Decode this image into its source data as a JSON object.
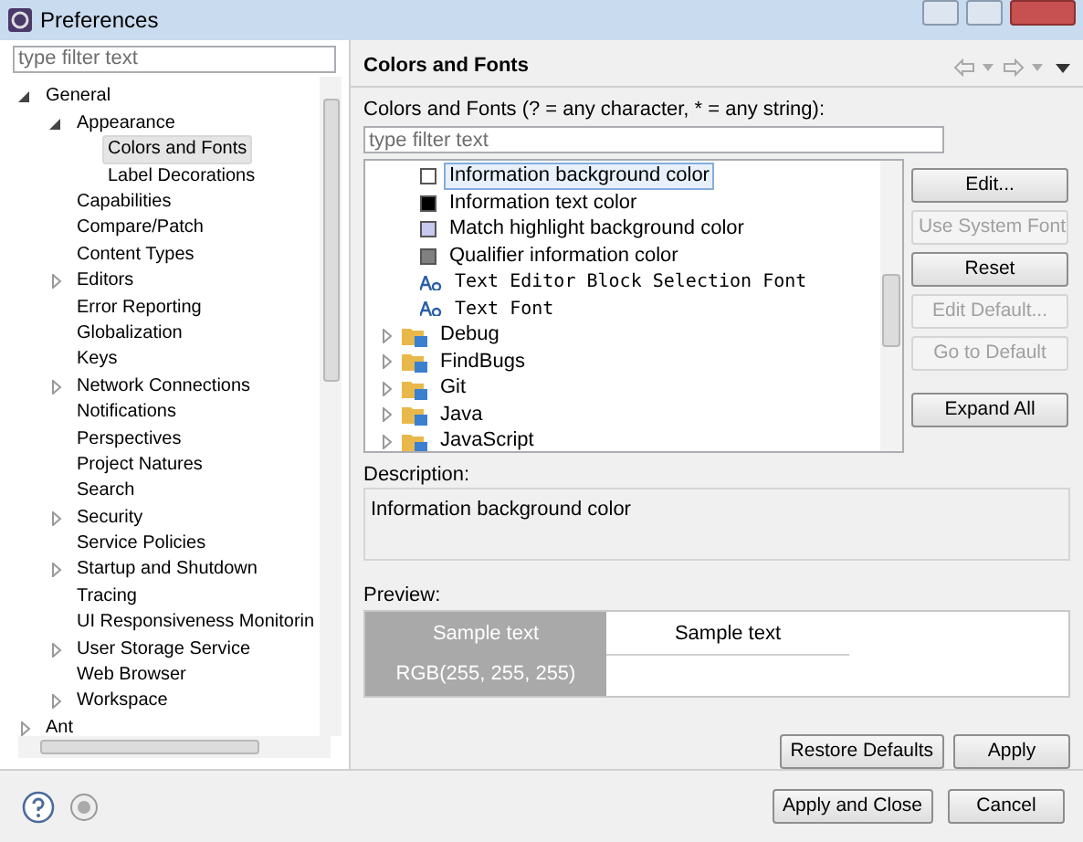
{
  "window": {
    "title": "Preferences"
  },
  "sidebar": {
    "filter": {
      "placeholder": "type filter text"
    },
    "tree": [
      {
        "label": "General",
        "expanded": true,
        "selected": false,
        "children": [
          {
            "label": "Appearance",
            "expanded": true,
            "selected": false,
            "children": [
              {
                "label": "Colors and Fonts",
                "selected": true
              },
              {
                "label": "Label Decorations",
                "selected": false
              }
            ]
          },
          {
            "label": "Capabilities",
            "selected": false
          },
          {
            "label": "Compare/Patch",
            "selected": false
          },
          {
            "label": "Content Types",
            "selected": false
          },
          {
            "label": "Editors",
            "expanded": false,
            "selected": false
          },
          {
            "label": "Error Reporting",
            "selected": false
          },
          {
            "label": "Globalization",
            "selected": false
          },
          {
            "label": "Keys",
            "selected": false
          },
          {
            "label": "Network Connections",
            "expanded": false,
            "selected": false
          },
          {
            "label": "Notifications",
            "selected": false
          },
          {
            "label": "Perspectives",
            "selected": false
          },
          {
            "label": "Project Natures",
            "selected": false
          },
          {
            "label": "Search",
            "selected": false
          },
          {
            "label": "Security",
            "expanded": false,
            "selected": false
          },
          {
            "label": "Service Policies",
            "selected": false
          },
          {
            "label": "Startup and Shutdown",
            "expanded": false,
            "selected": false
          },
          {
            "label": "Tracing",
            "selected": false
          },
          {
            "label": "UI Responsiveness Monitorin",
            "selected": false
          },
          {
            "label": "User Storage Service",
            "expanded": false,
            "selected": false
          },
          {
            "label": "Web Browser",
            "selected": false
          },
          {
            "label": "Workspace",
            "expanded": false,
            "selected": false
          }
        ]
      },
      {
        "label": "Ant",
        "expanded": false,
        "selected": false
      }
    ]
  },
  "page": {
    "title": "Colors and Fonts",
    "filter_label": "Colors and Fonts (? = any character, * = any string):",
    "filter": {
      "placeholder": "type filter text"
    },
    "items": [
      {
        "kind": "color",
        "label": "Information background color",
        "color": "#ffffff",
        "selected": true
      },
      {
        "kind": "color",
        "label": "Information text color",
        "color": "#000000",
        "selected": false
      },
      {
        "kind": "color",
        "label": "Match highlight background color",
        "color": "#c8c8f0",
        "selected": false
      },
      {
        "kind": "color",
        "label": "Qualifier information color",
        "color": "#808080",
        "selected": false
      },
      {
        "kind": "font",
        "label": "Text Editor Block Selection Font",
        "selected": false
      },
      {
        "kind": "font",
        "label": "Text Font",
        "selected": false
      },
      {
        "kind": "category",
        "label": "Debug",
        "selected": false
      },
      {
        "kind": "category",
        "label": "FindBugs",
        "selected": false
      },
      {
        "kind": "category",
        "label": "Git",
        "selected": false
      },
      {
        "kind": "category",
        "label": "Java",
        "selected": false
      },
      {
        "kind": "category",
        "label": "JavaScript",
        "selected": false
      }
    ],
    "side_buttons": [
      {
        "label": "Edit...",
        "disabled": false
      },
      {
        "label": "Use System Font",
        "disabled": true
      },
      {
        "label": "Reset",
        "disabled": false
      },
      {
        "label": "Edit Default...",
        "disabled": true
      },
      {
        "label": "Go to Default",
        "disabled": true
      },
      {
        "label": "Expand All",
        "disabled": false
      }
    ],
    "description_label": "Description:",
    "description": "Information background color",
    "preview_label": "Preview:",
    "preview": {
      "sample_dark": "Sample text",
      "rgb": "RGB(255, 255, 255)",
      "sample_light": "Sample text"
    },
    "buttons": [
      "Restore Defaults",
      "Apply"
    ]
  },
  "footer_buttons": [
    "Apply and Close",
    "Cancel"
  ]
}
